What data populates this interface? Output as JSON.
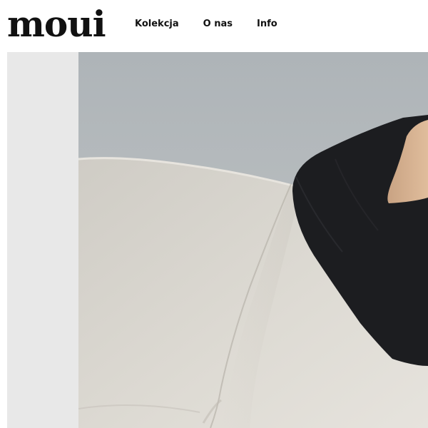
{
  "brand": {
    "logo_text": "moui"
  },
  "nav": {
    "items": [
      {
        "label": "Kolekcja"
      },
      {
        "label": "O nas"
      },
      {
        "label": "Info"
      }
    ]
  },
  "colors": {
    "text": "#111111",
    "side_panel": "#e8e8e8",
    "wall": "#b9bec1",
    "sofa": "#d9d6cf",
    "garment": "#1c1d20"
  },
  "hero": {
    "image_subject": "photo"
  }
}
